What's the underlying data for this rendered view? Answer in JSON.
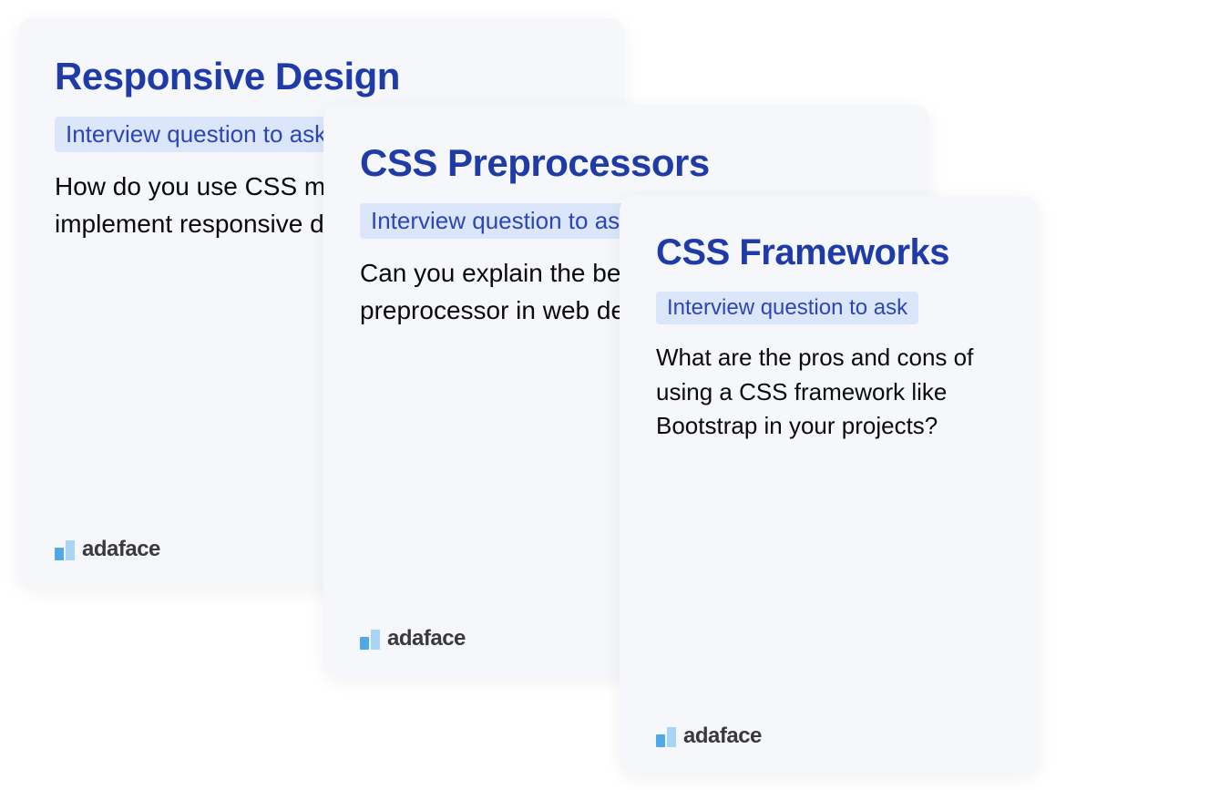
{
  "cards": [
    {
      "title": "Responsive Design",
      "subtitle": "Interview question to ask",
      "question": "How do you use CSS media queries to implement responsive design?",
      "brand": "adaface"
    },
    {
      "title": "CSS Preprocessors",
      "subtitle": "Interview question to ask",
      "question": "Can you explain the benefits of using a CSS preprocessor in web development?",
      "brand": "adaface"
    },
    {
      "title": "CSS Frameworks",
      "subtitle": "Interview question to ask",
      "question": "What are the pros and cons of using a CSS framework like Bootstrap in your projects?",
      "brand": "adaface"
    }
  ]
}
